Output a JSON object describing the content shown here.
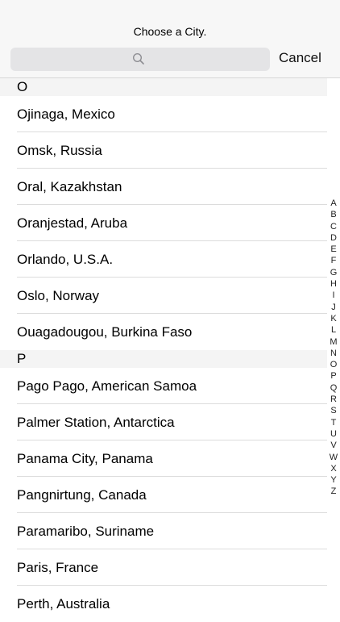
{
  "header": {
    "title": "Choose a City.",
    "search_placeholder": "",
    "cancel_label": "Cancel"
  },
  "sections": [
    {
      "letter": "O",
      "cities": [
        "Ojinaga, Mexico",
        "Omsk, Russia",
        "Oral, Kazakhstan",
        "Oranjestad, Aruba",
        "Orlando, U.S.A.",
        "Oslo, Norway",
        "Ouagadougou, Burkina Faso"
      ]
    },
    {
      "letter": "P",
      "cities": [
        "Pago Pago, American Samoa",
        "Palmer Station, Antarctica",
        "Panama City, Panama",
        "Pangnirtung, Canada",
        "Paramaribo, Suriname",
        "Paris, France",
        "Perth, Australia"
      ]
    }
  ],
  "index_letters": [
    "A",
    "B",
    "C",
    "D",
    "E",
    "F",
    "G",
    "H",
    "I",
    "J",
    "K",
    "L",
    "M",
    "N",
    "O",
    "P",
    "Q",
    "R",
    "S",
    "T",
    "U",
    "V",
    "W",
    "X",
    "Y",
    "Z"
  ],
  "colors": {
    "header_bg": "#f7f7f7",
    "search_bg": "#e4e4e6",
    "section_bg": "#f4f4f4",
    "separator": "#dcdcdc"
  }
}
